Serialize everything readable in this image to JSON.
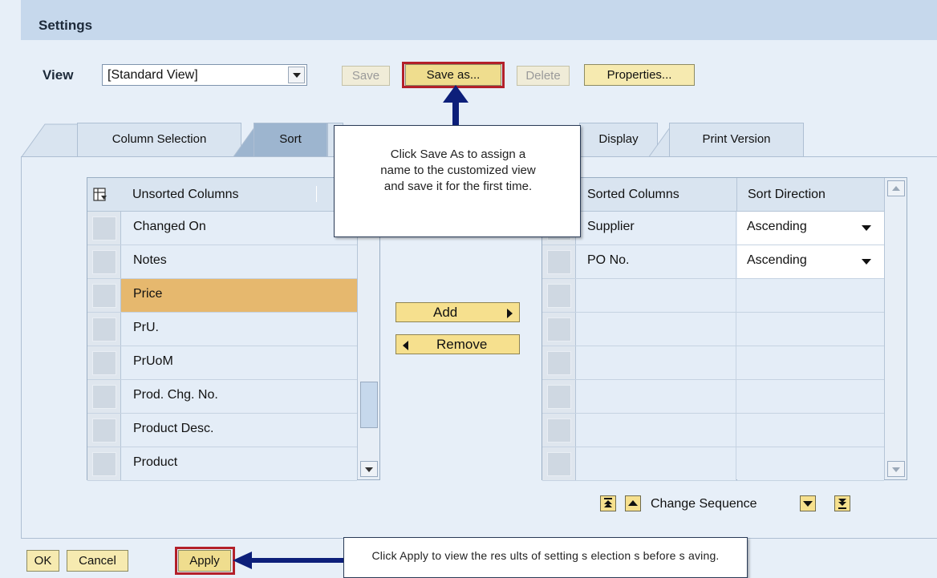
{
  "header": {
    "title": "Settings"
  },
  "view": {
    "label": "View",
    "selected": "[Standard View]"
  },
  "toolbar": {
    "save": "Save",
    "save_as": "Save as...",
    "delete": "Delete",
    "properties": "Properties..."
  },
  "tabs": [
    {
      "label": "Column Selection"
    },
    {
      "label": "Sort"
    },
    {
      "label": "Display"
    },
    {
      "label": "Print Version"
    }
  ],
  "unsorted": {
    "header": "Unsorted Columns",
    "rows": [
      "Changed On",
      "Notes",
      "Price",
      "PrU.",
      "PrUoM",
      "Prod. Chg. No.",
      "Product Desc.",
      "Product"
    ],
    "selected_row": "Price"
  },
  "actions": {
    "add": "Add",
    "remove": "Remove"
  },
  "sorted": {
    "header_columns": "Sorted Columns",
    "header_direction": "Sort Direction",
    "rows": [
      {
        "column": "Supplier",
        "direction": "Ascending"
      },
      {
        "column": "PO No.",
        "direction": "Ascending"
      }
    ]
  },
  "sequence": {
    "label": "Change Sequence"
  },
  "footer": {
    "ok": "OK",
    "cancel": "Cancel",
    "apply": "Apply"
  },
  "callouts": {
    "save_as": "Click Save As to assign a\nname to the customized view\nand save it for the first time.",
    "apply": "Click Apply to view  the res ults of setting s election s before s aving."
  },
  "colors": {
    "panel": "#e7eff8",
    "header": "#c6d8ec",
    "button": "#f6eab0",
    "selected_row": "#e6b86e",
    "highlight": "#b3202a",
    "arrow": "#0d1f7a"
  }
}
